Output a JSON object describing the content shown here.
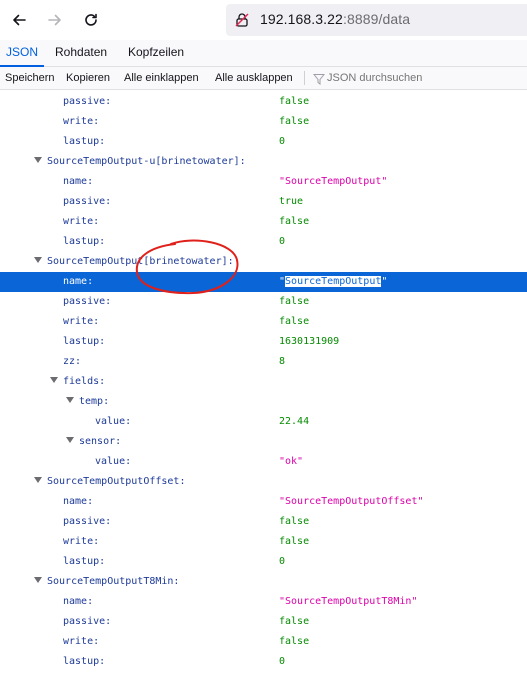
{
  "browser": {
    "url_host": "192.168.3.22",
    "url_rest": ":8889/data"
  },
  "tabs": [
    "JSON",
    "Rohdaten",
    "Kopfzeilen"
  ],
  "toolbar": {
    "save": "Speichern",
    "copy": "Kopieren",
    "collapse_all": "Alle einklappen",
    "expand_all": "Alle ausklappen",
    "filter_placeholder": "JSON durchsuchen"
  },
  "rows": [
    {
      "k": "passive:",
      "v": "false"
    },
    {
      "k": "write:",
      "v": "false"
    },
    {
      "k": "lastup:",
      "v": "0"
    },
    {
      "k": "SourceTempOutput-u[brinetowater]:",
      "v": ""
    },
    {
      "k": "name:",
      "v": "\"SourceTempOutput\""
    },
    {
      "k": "passive:",
      "v": "true"
    },
    {
      "k": "write:",
      "v": "false"
    },
    {
      "k": "lastup:",
      "v": "0"
    },
    {
      "k": "SourceTempOutput[brinetowater]:",
      "v": ""
    },
    {
      "k": "name:",
      "v": "\"SourceTempOutput\""
    },
    {
      "k": "passive:",
      "v": "false"
    },
    {
      "k": "write:",
      "v": "false"
    },
    {
      "k": "lastup:",
      "v": "1630131909"
    },
    {
      "k": "zz:",
      "v": "8"
    },
    {
      "k": "fields:",
      "v": ""
    },
    {
      "k": "temp:",
      "v": ""
    },
    {
      "k": "value:",
      "v": "22.44"
    },
    {
      "k": "sensor:",
      "v": ""
    },
    {
      "k": "value:",
      "v": "\"ok\""
    },
    {
      "k": "SourceTempOutputOffset:",
      "v": ""
    },
    {
      "k": "name:",
      "v": "\"SourceTempOutputOffset\""
    },
    {
      "k": "passive:",
      "v": "false"
    },
    {
      "k": "write:",
      "v": "false"
    },
    {
      "k": "lastup:",
      "v": "0"
    },
    {
      "k": "SourceTempOutputT8Min:",
      "v": ""
    },
    {
      "k": "name:",
      "v": "\"SourceTempOutputT8Min\""
    },
    {
      "k": "passive:",
      "v": "false"
    },
    {
      "k": "write:",
      "v": "false"
    },
    {
      "k": "lastup:",
      "v": "0"
    }
  ],
  "colors": {
    "selection": "#0a66d6",
    "key": "#1d3a98",
    "string": "#dd00a9",
    "number_boolean": "#058b00",
    "annotation": "#e0201a"
  }
}
